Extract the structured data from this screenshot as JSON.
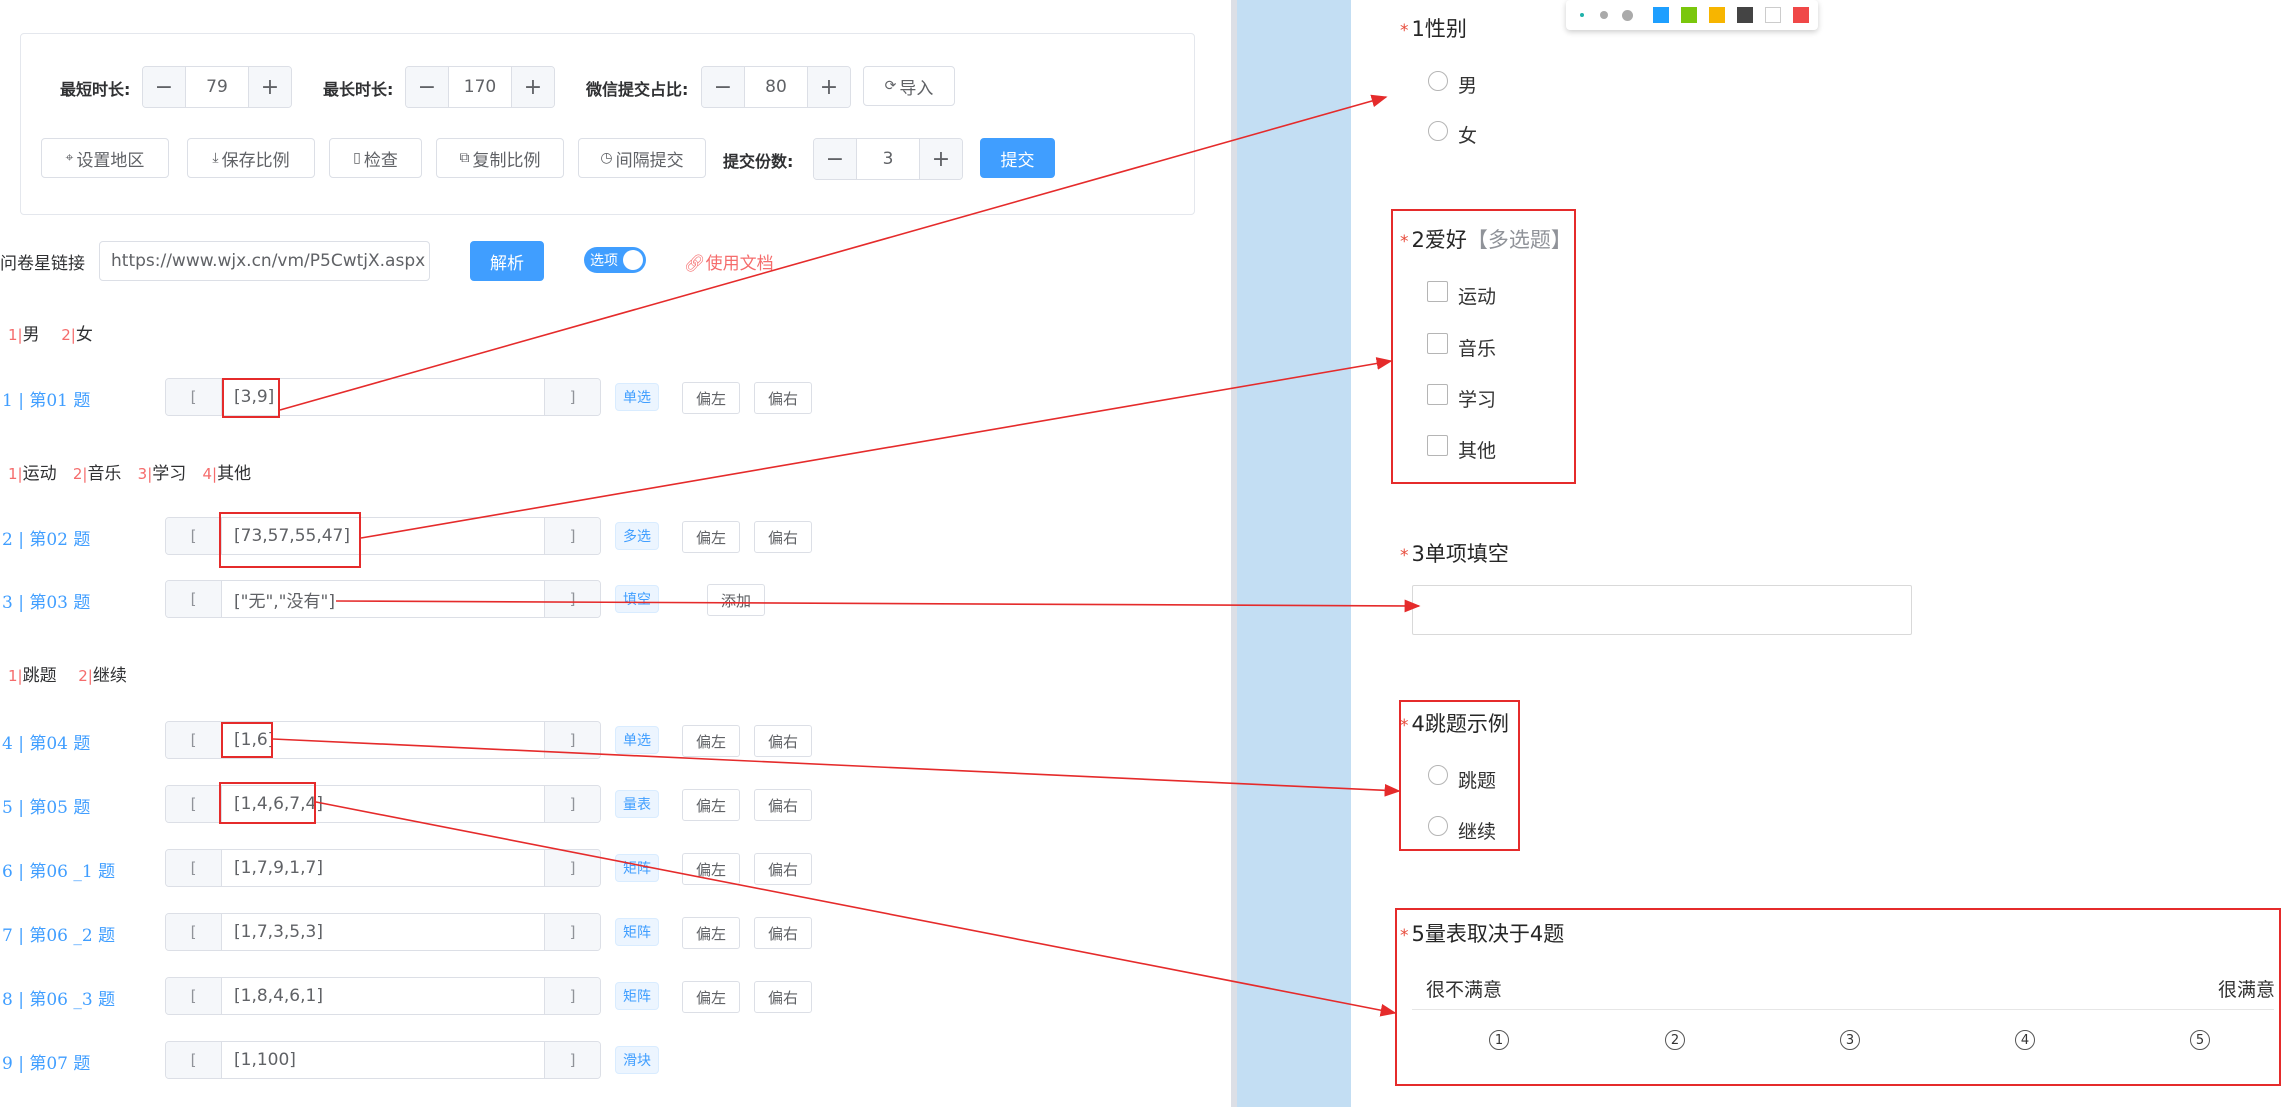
{
  "settings": {
    "min_duration": {
      "label": "最短时长:",
      "value": "79"
    },
    "max_duration": {
      "label": "最长时长:",
      "value": "170"
    },
    "wechat_ratio": {
      "label": "微信提交占比:",
      "value": "80"
    },
    "import_label": "导入",
    "set_region_label": "设置地区",
    "save_ratio_label": "保存比例",
    "check_label": "检查",
    "copy_ratio_label": "复制比例",
    "interval_submit_label": "间隔提交",
    "submit_count": {
      "label": "提交份数:",
      "value": "3"
    },
    "submit_label": "提交"
  },
  "url_bar": {
    "label": "问卷星链接",
    "value": "https://www.wjx.cn/vm/P5CwtjX.aspx",
    "parse_label": "解析",
    "switch_label": "选项",
    "docs_label": "使用文档"
  },
  "option_hints": [
    {
      "options": [
        {
          "n": "1|",
          "t": "男"
        },
        {
          "n": "2|",
          "t": "女"
        }
      ]
    },
    {
      "options": [
        {
          "n": "1|",
          "t": "运动"
        },
        {
          "n": "2|",
          "t": "音乐"
        },
        {
          "n": "3|",
          "t": "学习"
        },
        {
          "n": "4|",
          "t": "其他"
        }
      ]
    },
    {
      "options": [
        {
          "n": "1|",
          "t": "跳题"
        },
        {
          "n": "2|",
          "t": "继续"
        }
      ]
    }
  ],
  "answer_rows": [
    {
      "label": "1 | 第01    题",
      "value": "[3,9]",
      "tag": "单选",
      "buttons": [
        "偏左",
        "偏右"
      ]
    },
    {
      "label": "2 | 第02    题",
      "value": "[73,57,55,47]",
      "tag": "多选",
      "buttons": [
        "偏左",
        "偏右"
      ]
    },
    {
      "label": "3 | 第03    题",
      "value": "[\"无\",\"没有\"]",
      "tag": "填空",
      "buttons": [
        "添加"
      ]
    },
    {
      "label": "4 | 第04    题",
      "value": "[1,6]",
      "tag": "单选",
      "buttons": [
        "偏左",
        "偏右"
      ]
    },
    {
      "label": "5 | 第05    题",
      "value": "[1,4,6,7,4]",
      "tag": "量表",
      "buttons": [
        "偏左",
        "偏右"
      ]
    },
    {
      "label": "6 | 第06 _1 题",
      "value": "[1,7,9,1,7]",
      "tag": "矩阵",
      "buttons": [
        "偏左",
        "偏右"
      ]
    },
    {
      "label": "7 | 第06 _2 题",
      "value": "[1,7,3,5,3]",
      "tag": "矩阵",
      "buttons": [
        "偏左",
        "偏右"
      ]
    },
    {
      "label": "8 | 第06 _3 题",
      "value": "[1,8,4,6,1]",
      "tag": "矩阵",
      "buttons": [
        "偏左",
        "偏右"
      ]
    },
    {
      "label": "9 | 第07    题",
      "value": "[1,100]",
      "tag": "滑块",
      "buttons": []
    }
  ],
  "bracket_open": "[",
  "bracket_close": "]",
  "survey": {
    "q1": {
      "star": "*",
      "title": "1性别",
      "options": [
        "男",
        "女"
      ]
    },
    "q2": {
      "star": "*",
      "title": "2爱好",
      "subtitle": "【多选题】",
      "options": [
        "运动",
        "音乐",
        "学习",
        "其他"
      ]
    },
    "q3": {
      "star": "*",
      "title": "3单项填空"
    },
    "q4": {
      "star": "*",
      "title": "4跳题示例",
      "options": [
        "跳题",
        "继续"
      ]
    },
    "q5": {
      "star": "*",
      "title": "5量表取决于4题",
      "low_label": "很不满意",
      "high_label": "很满意",
      "scale": [
        "1",
        "2",
        "3",
        "4",
        "5"
      ]
    }
  },
  "palette_colors": [
    "#1e9fff",
    "#7ac70c",
    "#f7b500",
    "#444444",
    "#ffffff",
    "#f04848"
  ]
}
